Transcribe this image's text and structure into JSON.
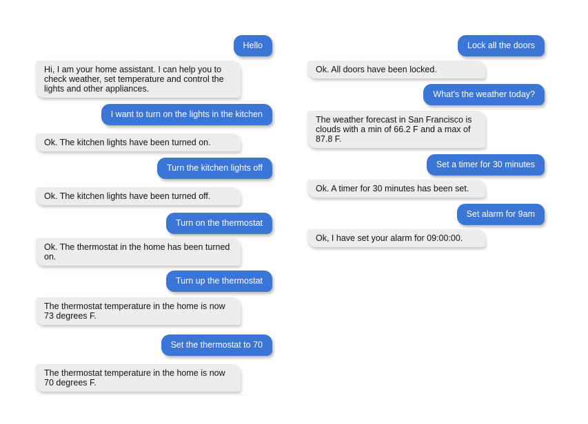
{
  "conversation": {
    "left": [
      {
        "sender": "user",
        "text": "Hello"
      },
      {
        "sender": "bot",
        "text": "Hi, I am your home assistant. I can help you to check weather, set temperature and control the lights and other appliances."
      },
      {
        "sender": "user",
        "text": "I want to turn on the lights in the kitchen"
      },
      {
        "sender": "bot",
        "text": "Ok. The kitchen lights have been turned on."
      },
      {
        "sender": "user",
        "text": "Turn the kitchen lights off"
      },
      {
        "sender": "bot",
        "text": "Ok. The kitchen lights have been turned off."
      },
      {
        "sender": "user",
        "text": "Turn on the thermostat"
      },
      {
        "sender": "bot",
        "text": "Ok. The thermostat in the home has been turned on."
      },
      {
        "sender": "user",
        "text": "Turn up the thermostat"
      },
      {
        "sender": "bot",
        "text": "The thermostat temperature in the home is now 73 degrees F."
      },
      {
        "sender": "user",
        "text": "Set the thermostat to 70"
      },
      {
        "sender": "bot",
        "text": "The thermostat temperature in the home is now 70 degrees F."
      }
    ],
    "right": [
      {
        "sender": "user",
        "text": "Lock all the doors"
      },
      {
        "sender": "bot",
        "text": "Ok. All doors have been locked."
      },
      {
        "sender": "user",
        "text": "What's the weather today?"
      },
      {
        "sender": "bot",
        "text": "The weather forecast in San Francisco is clouds with a min of 66.2 F and a max of 87.8 F."
      },
      {
        "sender": "user",
        "text": "Set a timer for 30 minutes"
      },
      {
        "sender": "bot",
        "text": "Ok. A timer for 30 minutes has been set."
      },
      {
        "sender": "user",
        "text": "Set alarm for 9am"
      },
      {
        "sender": "bot",
        "text": "Ok, I have set your alarm for 09:00:00."
      }
    ]
  },
  "colors": {
    "user_bubble": "#3b75d5",
    "bot_bubble": "#ececec"
  }
}
